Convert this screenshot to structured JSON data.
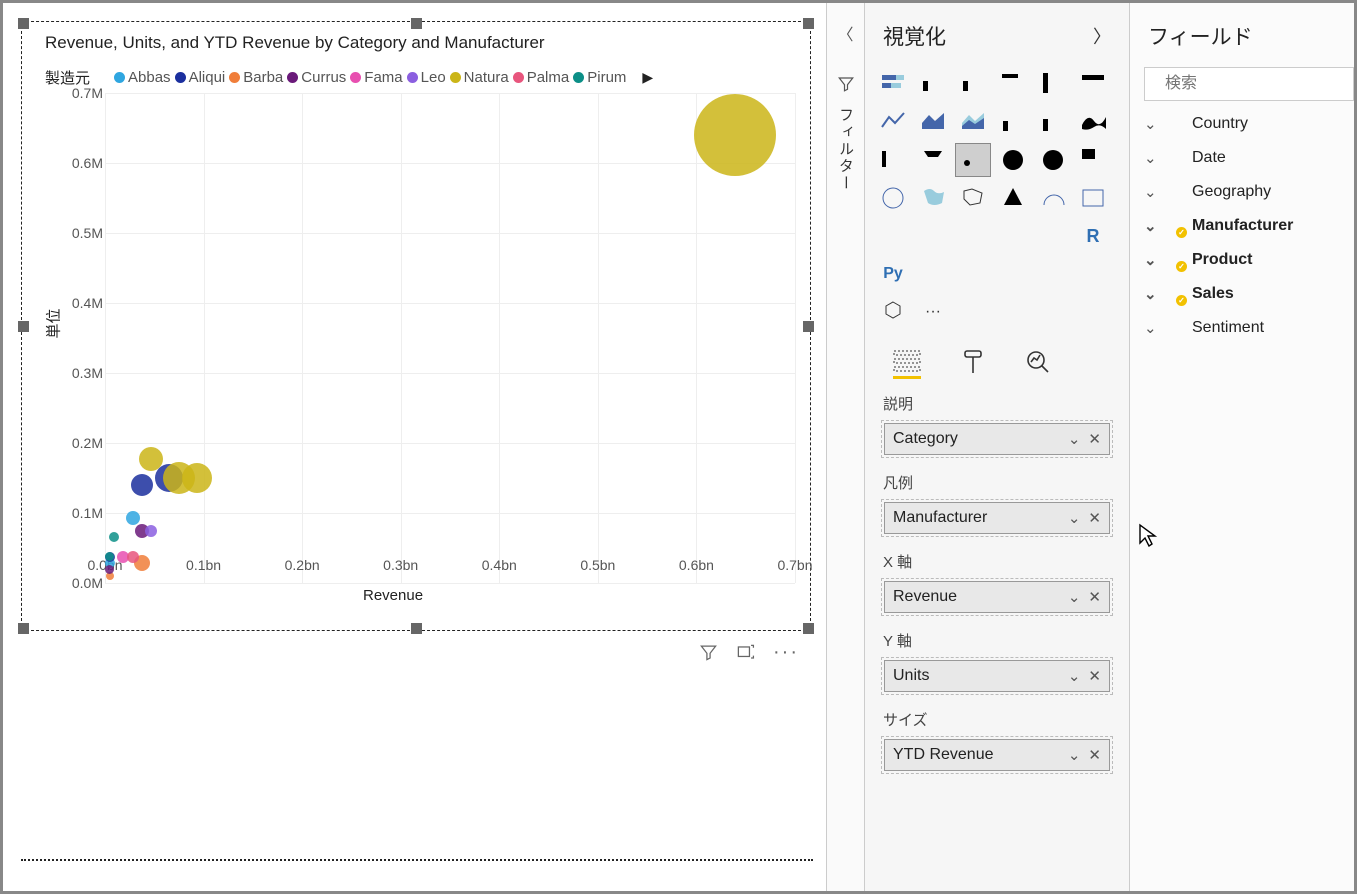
{
  "panels": {
    "visualizations_title": "視覚化",
    "fields_title": "フィールド",
    "filters_label": "フィルター"
  },
  "search": {
    "placeholder": "検索"
  },
  "chart": {
    "title": "Revenue, Units, and YTD Revenue by Category and Manufacturer",
    "legend_title": "製造元",
    "x_label": "Revenue",
    "y_label": "単位",
    "y_ticks": [
      "0.0M",
      "0.1M",
      "0.2M",
      "0.3M",
      "0.4M",
      "0.5M",
      "0.6M",
      "0.7M"
    ],
    "x_ticks": [
      "0.0bn",
      "0.1bn",
      "0.2bn",
      "0.3bn",
      "0.4bn",
      "0.5bn",
      "0.6bn",
      "0.7bn"
    ],
    "legend_items": [
      {
        "name": "Abbas",
        "color": "#2fa6e0"
      },
      {
        "name": "Aliqui",
        "color": "#1b2f9e"
      },
      {
        "name": "Barba",
        "color": "#f07e3a"
      },
      {
        "name": "Currus",
        "color": "#6a1a7a"
      },
      {
        "name": "Fama",
        "color": "#e84fb0"
      },
      {
        "name": "Leo",
        "color": "#8b5fe0"
      },
      {
        "name": "Natura",
        "color": "#cbb518"
      },
      {
        "name": "Palma",
        "color": "#e8557d"
      },
      {
        "name": "Pirum",
        "color": "#0c8f87"
      }
    ]
  },
  "chart_data": {
    "type": "scatter",
    "xlabel": "Revenue",
    "ylabel": "単位",
    "xlim": [
      0,
      0.75
    ],
    "ylim": [
      0,
      0.75
    ],
    "x_unit": "bn",
    "y_unit": "M",
    "size_field": "YTD Revenue",
    "series": [
      {
        "name": "Abbas",
        "color": "#2fa6e0",
        "points": [
          {
            "x": 0.005,
            "y": 0.03,
            "size": 10
          },
          {
            "x": 0.03,
            "y": 0.1,
            "size": 14
          }
        ]
      },
      {
        "name": "Aliqui",
        "color": "#1b2f9e",
        "points": [
          {
            "x": 0.005,
            "y": 0.04,
            "size": 10
          },
          {
            "x": 0.04,
            "y": 0.15,
            "size": 22
          },
          {
            "x": 0.07,
            "y": 0.16,
            "size": 28
          }
        ]
      },
      {
        "name": "Barba",
        "color": "#f07e3a",
        "points": [
          {
            "x": 0.005,
            "y": 0.01,
            "size": 8
          },
          {
            "x": 0.04,
            "y": 0.03,
            "size": 16
          }
        ]
      },
      {
        "name": "Currus",
        "color": "#6a1a7a",
        "points": [
          {
            "x": 0.005,
            "y": 0.02,
            "size": 9
          },
          {
            "x": 0.04,
            "y": 0.08,
            "size": 14
          }
        ]
      },
      {
        "name": "Fama",
        "color": "#e84fb0",
        "points": [
          {
            "x": 0.02,
            "y": 0.04,
            "size": 12
          }
        ]
      },
      {
        "name": "Leo",
        "color": "#8b5fe0",
        "points": [
          {
            "x": 0.05,
            "y": 0.08,
            "size": 12
          }
        ]
      },
      {
        "name": "Natura",
        "color": "#cbb518",
        "points": [
          {
            "x": 0.05,
            "y": 0.19,
            "size": 24
          },
          {
            "x": 0.08,
            "y": 0.16,
            "size": 32
          },
          {
            "x": 0.1,
            "y": 0.16,
            "size": 30
          },
          {
            "x": 0.685,
            "y": 0.685,
            "size": 82
          }
        ]
      },
      {
        "name": "Palma",
        "color": "#e8557d",
        "points": [
          {
            "x": 0.03,
            "y": 0.04,
            "size": 12
          }
        ]
      },
      {
        "name": "Pirum",
        "color": "#0c8f87",
        "points": [
          {
            "x": 0.005,
            "y": 0.04,
            "size": 9
          },
          {
            "x": 0.01,
            "y": 0.07,
            "size": 10
          }
        ]
      }
    ]
  },
  "wells": {
    "detail_label": "説明",
    "detail_value": "Category",
    "legend_label": "凡例",
    "legend_value": "Manufacturer",
    "x_label": "X 軸",
    "x_value": "Revenue",
    "y_label": "Y 軸",
    "y_value": "Units",
    "size_label": "サイズ",
    "size_value": "YTD Revenue"
  },
  "fields": [
    {
      "name": "Country",
      "bold": false,
      "badge": false
    },
    {
      "name": "Date",
      "bold": false,
      "badge": false
    },
    {
      "name": "Geography",
      "bold": false,
      "badge": false
    },
    {
      "name": "Manufacturer",
      "bold": true,
      "badge": true
    },
    {
      "name": "Product",
      "bold": true,
      "badge": true
    },
    {
      "name": "Sales",
      "bold": true,
      "badge": true
    },
    {
      "name": "Sentiment",
      "bold": false,
      "badge": false
    }
  ]
}
